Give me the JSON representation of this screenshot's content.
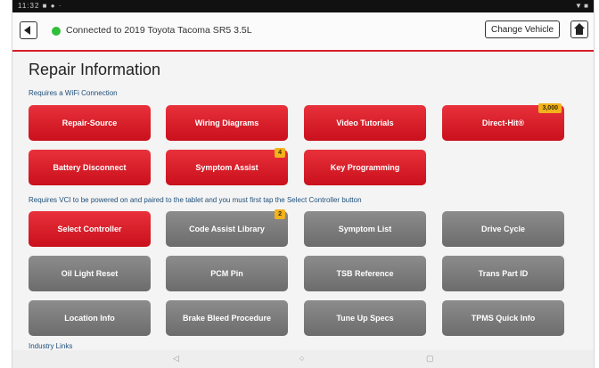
{
  "status_bar": {
    "left": "11:32 ■ ● ·",
    "right": "▼ ■"
  },
  "header": {
    "connection_text": "Connected to 2019 Toyota Tacoma SR5 3.5L",
    "change_vehicle_label": "Change Vehicle",
    "connection_color": "#2fbf3a",
    "accent_color": "#d61e2a"
  },
  "page": {
    "title": "Repair Information",
    "wifi_section_label": "Requires a WiFi Connection",
    "vci_section_label": "Requires VCI to be powered on and paired to the tablet and you must first tap the Select Controller button",
    "industry_links_label": "Industry Links"
  },
  "wifi_tiles": [
    {
      "label": "Repair-Source",
      "badge": null
    },
    {
      "label": "Wiring Diagrams",
      "badge": null
    },
    {
      "label": "Video Tutorials",
      "badge": null
    },
    {
      "label": "Direct-Hit®",
      "badge": "3,000"
    },
    {
      "label": "Battery Disconnect",
      "badge": null
    },
    {
      "label": "Symptom Assist",
      "badge": "4"
    },
    {
      "label": "Key Programming",
      "badge": null
    }
  ],
  "vci_tiles": [
    {
      "label": "Select Controller",
      "badge": null
    },
    {
      "label": "Code Assist Library",
      "badge": "2"
    },
    {
      "label": "Symptom List",
      "badge": null
    },
    {
      "label": "Drive Cycle",
      "badge": null
    },
    {
      "label": "Oil Light Reset",
      "badge": null
    },
    {
      "label": "PCM Pin",
      "badge": null
    },
    {
      "label": "TSB Reference",
      "badge": null
    },
    {
      "label": "Trans Part ID",
      "badge": null
    },
    {
      "label": "Location Info",
      "badge": null
    },
    {
      "label": "Brake Bleed Procedure",
      "badge": null
    },
    {
      "label": "Tune Up Specs",
      "badge": null
    },
    {
      "label": "TPMS Quick Info",
      "badge": null
    }
  ],
  "nav_bar": {
    "back": "◁",
    "home": "○",
    "recents": "▢"
  }
}
